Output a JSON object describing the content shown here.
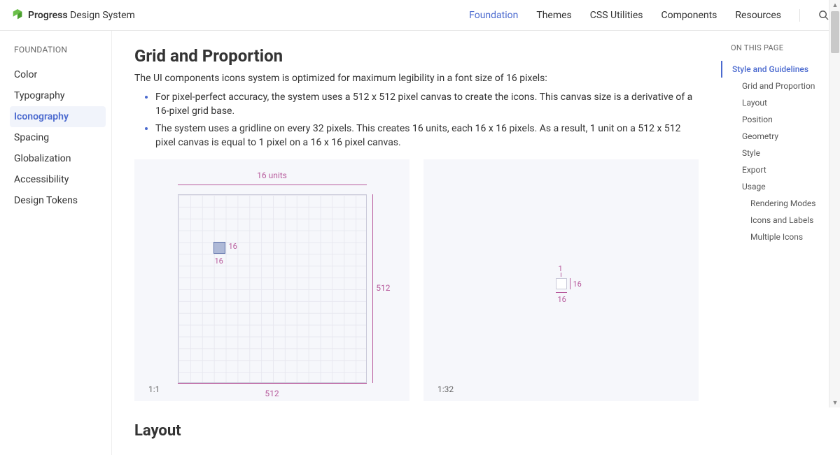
{
  "brand": {
    "name_bold": "Progress",
    "name_light": " Design System"
  },
  "topnav": {
    "items": [
      "Foundation",
      "Themes",
      "CSS Utilities",
      "Components",
      "Resources"
    ],
    "active": 0
  },
  "sidebar": {
    "title": "FOUNDATION",
    "items": [
      "Color",
      "Typography",
      "Iconography",
      "Spacing",
      "Globalization",
      "Accessibility",
      "Design Tokens"
    ],
    "active": 2
  },
  "page": {
    "title": "Grid and Proportion",
    "intro": "The UI components icons system is optimized for maximum legibility in a font size of 16 pixels:",
    "bullets": [
      "For pixel-perfect accuracy, the system uses a 512 x 512 pixel canvas to create the icons. This canvas size is a derivative of a 16-pixel grid base.",
      "The system uses a gridline on every 32 pixels. This creates 16 units, each 16 x 16 pixels. As a result, 1 unit on a 512 x 512 pixel canvas is equal to 1 pixel on a 16 x 16 pixel canvas."
    ],
    "fig": {
      "units": "16 units",
      "dim512": "512",
      "cell16": "16",
      "one": "1",
      "small16": "16",
      "ratio_a": "1:1",
      "ratio_b": "1:32"
    },
    "section2": "Layout"
  },
  "rightpanel": {
    "title": "ON THIS PAGE",
    "items": [
      {
        "label": "Style and Guidelines",
        "level": 0,
        "active": true
      },
      {
        "label": "Grid and Proportion",
        "level": 1
      },
      {
        "label": "Layout",
        "level": 1
      },
      {
        "label": "Position",
        "level": 1
      },
      {
        "label": "Geometry",
        "level": 1
      },
      {
        "label": "Style",
        "level": 1
      },
      {
        "label": "Export",
        "level": 1
      },
      {
        "label": "Usage",
        "level": 1
      },
      {
        "label": "Rendering Modes",
        "level": 2
      },
      {
        "label": "Icons and Labels",
        "level": 2
      },
      {
        "label": "Multiple Icons",
        "level": 2
      }
    ]
  }
}
